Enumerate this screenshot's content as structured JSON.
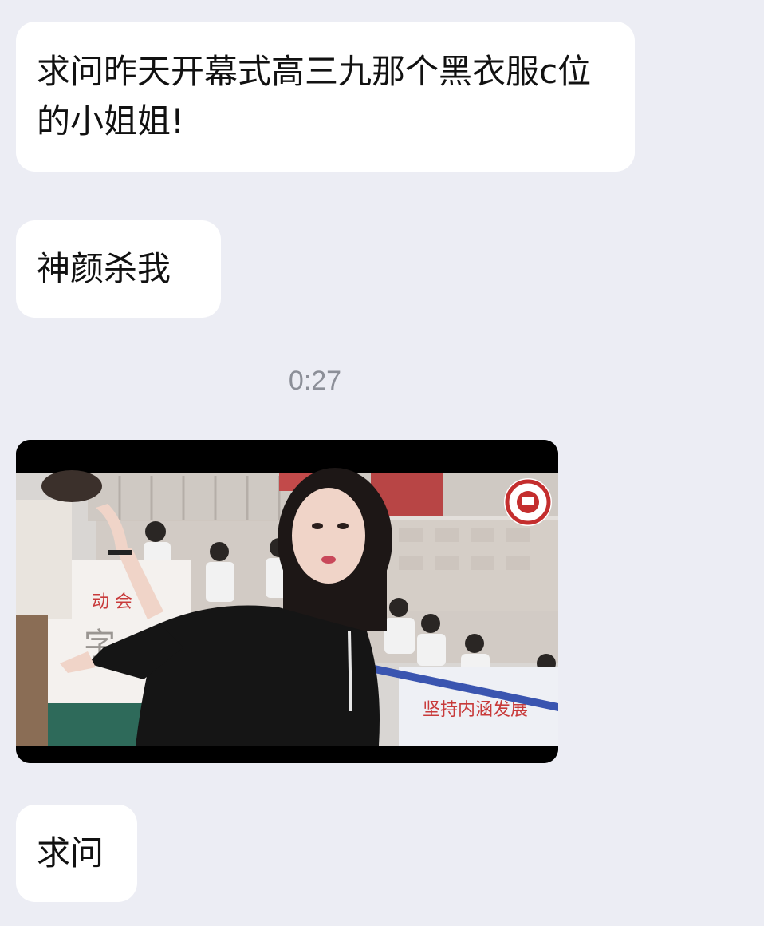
{
  "messages": [
    {
      "text": "求问昨天开幕式高三九那个黑衣服c位的小姐姐!"
    },
    {
      "text": "神颜杀我"
    },
    {
      "text": "求问"
    }
  ],
  "timestamp": "0:27",
  "video": {
    "thumbnail": "school-opening-ceremony-dance-frame",
    "icon": "school-emblem-icon"
  }
}
